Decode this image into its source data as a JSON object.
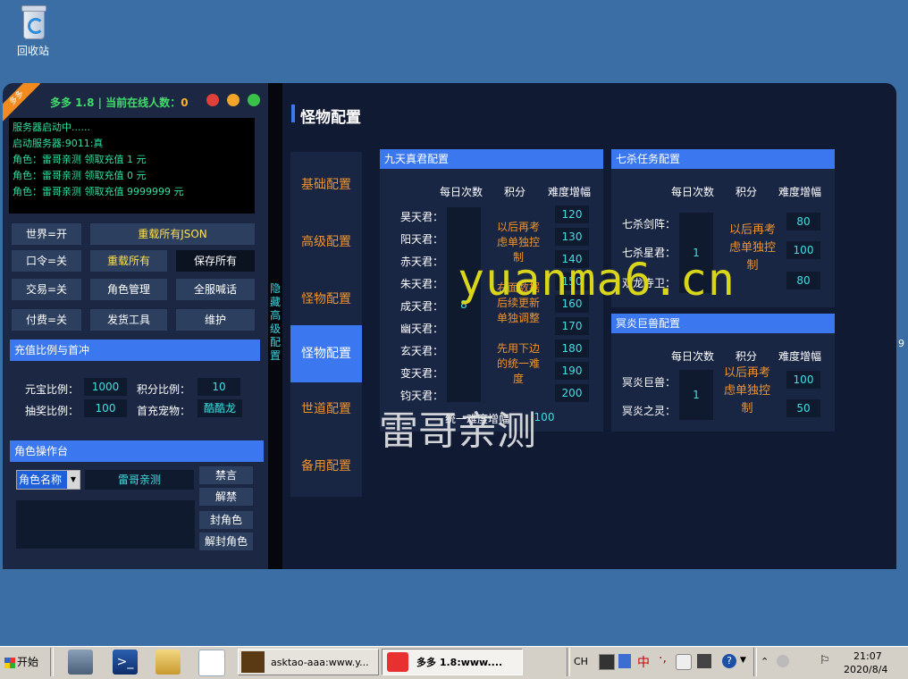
{
  "desktop": {
    "recycle_bin_label": "回收站"
  },
  "left_panel": {
    "ribbon": "多多",
    "title_prefix": "多多 1.8 | 当前在线人数：",
    "online_count": "0",
    "console_lines": [
      "服务器启动中......",
      "启动服务器:9011:真",
      "角色：雷哥亲测 领取充值 1 元",
      "角色：雷哥亲测 领取充值 0 元",
      "角色：雷哥亲测 领取充值 9999999 元"
    ],
    "buttons": {
      "world": "世界=开",
      "reload_json": "重载所有JSON",
      "command": "口令=关",
      "reload_all": "重载所有",
      "save_all": "保存所有",
      "trade": "交易=关",
      "role_manage": "角色管理",
      "shout": "全服喊话",
      "paid": "付费=关",
      "issue_tool": "发货工具",
      "maintain": "维护"
    },
    "recharge": {
      "header": "充值比例与首冲",
      "yuanbao_label": "元宝比例：",
      "yuanbao_value": "1000",
      "points_label": "积分比例：",
      "points_value": "10",
      "lottery_label": "抽奖比例：",
      "lottery_value": "100",
      "first_pet_label": "首充宠物：",
      "first_pet_value": "酷酷龙"
    },
    "role_ops": {
      "header": "角色操作台",
      "select_value": "角色名称",
      "input_value": "雷哥亲测",
      "mute": "禁言",
      "unmute": "解禁",
      "ban": "封角色",
      "unban": "解封角色"
    }
  },
  "hidden_config": "隐藏高级配置",
  "right_panel": {
    "title": "怪物配置",
    "nav": [
      "基础配置",
      "高级配置",
      "怪物配置",
      "怪物配置",
      "世道配置",
      "备用配置"
    ],
    "jiutian": {
      "header": "九天真君配置",
      "col_daily": "每日次数",
      "col_points": "积分",
      "col_diff": "难度增幅",
      "names": [
        "昊天君：",
        "阳天君：",
        "赤天君：",
        "朱天君：",
        "成天君：",
        "幽天君：",
        "玄天君：",
        "变天君：",
        "钧天君："
      ],
      "daily": "8",
      "notes": [
        "以后再考虑单独控制",
        "右面数据后续更新单独调整",
        "先用下边的统一难度"
      ],
      "diffs": [
        "120",
        "130",
        "140",
        "150",
        "160",
        "170",
        "180",
        "190",
        "200"
      ],
      "unified_label": "统一难度增幅",
      "unified_value": "100"
    },
    "qisha": {
      "header": "七杀任务配置",
      "col_daily": "每日次数",
      "col_points": "积分",
      "col_diff": "难度增幅",
      "names": [
        "七杀剑阵：",
        "七杀星君：",
        "双龙寺卫："
      ],
      "daily": "1",
      "note": "以后再考虑单独控制",
      "diffs": [
        "80",
        "100",
        "80"
      ]
    },
    "mingyan": {
      "header": "冥炎巨兽配置",
      "col_daily": "每日次数",
      "col_points": "积分",
      "col_diff": "难度增幅",
      "names": [
        "冥炎巨兽：",
        "冥炎之灵："
      ],
      "daily": "1",
      "note": "以后再考虑单独控制",
      "diffs": [
        "100",
        "50"
      ]
    }
  },
  "watermarks": {
    "site": "yuanma6.cn",
    "tester": "雷哥亲测"
  },
  "edge_digit": "9",
  "taskbar": {
    "start": "开始",
    "tasks": [
      "asktao-aaa:www.y...",
      "多多 1.8:www...."
    ],
    "lang": "CH",
    "ime": "中",
    "time": "21:07",
    "date": "2020/8/4"
  }
}
